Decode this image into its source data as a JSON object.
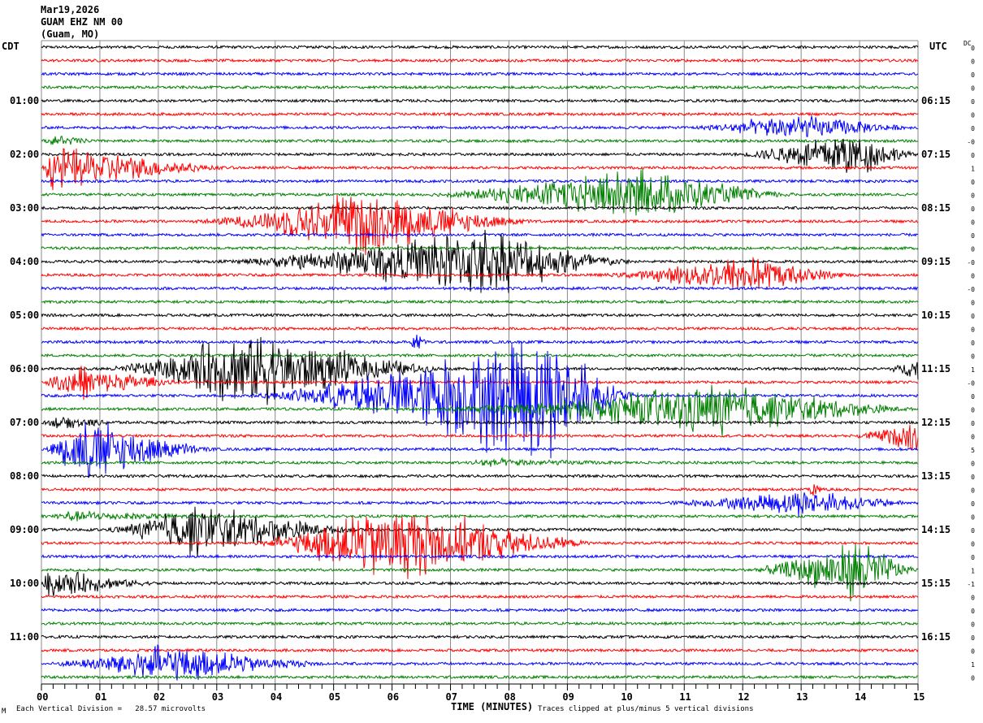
{
  "header": {
    "date": "Mar19,2026",
    "station": "GUAM EHZ NM 00",
    "location": "(Guam, MO)"
  },
  "chart_data": {
    "type": "line",
    "subtype": "helicorder",
    "left_timezone": "CDT",
    "right_timezone": "UTC",
    "dc_header": "DC",
    "xlabel": "TIME (MINUTES)",
    "xlim": [
      0,
      15
    ],
    "x_tick_labels": [
      "00",
      "01",
      "02",
      "03",
      "04",
      "05",
      "06",
      "07",
      "08",
      "09",
      "10",
      "11",
      "12",
      "13",
      "14",
      "15"
    ],
    "minutes_per_trace": 15,
    "trace_count": 48,
    "trace_colors": [
      "#000000",
      "#ff0000",
      "#0000ff",
      "#008000"
    ],
    "left_hour_labels": [
      "01:00",
      "02:00",
      "03:00",
      "04:00",
      "05:00",
      "06:00",
      "07:00",
      "08:00",
      "09:00",
      "10:00",
      "11:00"
    ],
    "right_hour_labels": [
      "06:15",
      "07:15",
      "08:15",
      "09:15",
      "10:15",
      "11:15",
      "12:15",
      "13:15",
      "14:15",
      "15:15",
      "16:15"
    ],
    "dc_offsets": [
      "0",
      "0",
      "0",
      "0",
      "0",
      "0",
      "0",
      "-0",
      "0",
      "1",
      "0",
      "0",
      "0",
      "0",
      "0",
      "0",
      "-0",
      "0",
      "-0",
      "0",
      "0",
      "0",
      "0",
      "0",
      "1",
      "-0",
      "0",
      "0",
      "0",
      "0",
      "5",
      "0",
      "0",
      "0",
      "0",
      "0",
      "0",
      "0",
      "0",
      "1",
      "-1",
      "0",
      "0",
      "0",
      "0",
      "0",
      "1",
      "0"
    ],
    "clip_divisions": 5,
    "events": [
      {
        "trace": 6,
        "start": 11.0,
        "peak": 12.8,
        "end": 15,
        "amp": 1.1
      },
      {
        "trace": 7,
        "start": 0,
        "peak": 0.3,
        "end": 1,
        "amp": 0.4
      },
      {
        "trace": 8,
        "start": 11.8,
        "peak": 13.8,
        "end": 15,
        "amp": 2.2
      },
      {
        "trace": 9,
        "start": 0,
        "peak": 0.2,
        "end": 3.2,
        "amp": 2.0
      },
      {
        "trace": 11,
        "start": 6.5,
        "peak": 10.0,
        "end": 13,
        "amp": 2.2
      },
      {
        "trace": 13,
        "start": 2.5,
        "peak": 5.5,
        "end": 8.5,
        "amp": 2.6
      },
      {
        "trace": 16,
        "start": 3.0,
        "peak": 7.5,
        "end": 10.2,
        "amp": 3.0
      },
      {
        "trace": 17,
        "start": 9.5,
        "peak": 12.0,
        "end": 14,
        "amp": 1.6
      },
      {
        "trace": 22,
        "start": 6.3,
        "peak": 6.4,
        "end": 6.6,
        "amp": 1.1
      },
      {
        "trace": 24,
        "start": 1.0,
        "peak": 3.5,
        "end": 7.0,
        "amp": 3.2
      },
      {
        "trace": 24,
        "start": 14.4,
        "peak": 15,
        "end": 15,
        "amp": 0.8
      },
      {
        "trace": 25,
        "start": 0,
        "peak": 0.5,
        "end": 2.5,
        "amp": 1.5
      },
      {
        "trace": 26,
        "start": 3.5,
        "peak": 8.5,
        "end": 10.2,
        "amp": 6.0
      },
      {
        "trace": 27,
        "start": 6.5,
        "peak": 11.5,
        "end": 15,
        "amp": 2.2
      },
      {
        "trace": 28,
        "start": 0,
        "peak": 0.3,
        "end": 1.5,
        "amp": 0.5
      },
      {
        "trace": 29,
        "start": 13.8,
        "peak": 15,
        "end": 15,
        "amp": 1.3
      },
      {
        "trace": 30,
        "start": 0,
        "peak": 0.7,
        "end": 3.0,
        "amp": 2.8
      },
      {
        "trace": 31,
        "start": 7.3,
        "peak": 7.5,
        "end": 10,
        "amp": 0.3
      },
      {
        "trace": 33,
        "start": 13.1,
        "peak": 13.2,
        "end": 13.4,
        "amp": 0.8
      },
      {
        "trace": 34,
        "start": 10.5,
        "peak": 13.0,
        "end": 15,
        "amp": 1.1
      },
      {
        "trace": 35,
        "start": 0,
        "peak": 0.5,
        "end": 3,
        "amp": 0.4
      },
      {
        "trace": 36,
        "start": 1.0,
        "peak": 2.6,
        "end": 5.5,
        "amp": 2.2
      },
      {
        "trace": 37,
        "start": 3.5,
        "peak": 6.0,
        "end": 9.5,
        "amp": 3.6
      },
      {
        "trace": 39,
        "start": 12.0,
        "peak": 14.0,
        "end": 15,
        "amp": 2.6
      },
      {
        "trace": 40,
        "start": 0,
        "peak": 0.1,
        "end": 2.0,
        "amp": 1.2
      },
      {
        "trace": 46,
        "start": 0,
        "peak": 2.0,
        "end": 5.0,
        "amp": 1.6
      }
    ]
  },
  "footer": {
    "corner_mark": "M",
    "division_text": "Each Vertical Division =   28.57 microvolts",
    "clip_text": "Traces clipped at plus/minus 5 vertical divisions"
  }
}
